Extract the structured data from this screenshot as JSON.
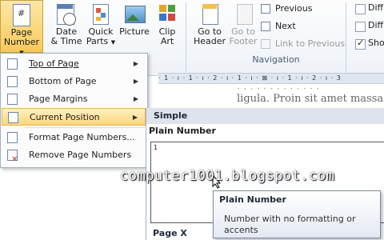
{
  "ribbon": {
    "buttons": [
      {
        "label1": "Page",
        "label2": "Number"
      },
      {
        "label1": "Date",
        "label2": "& Time"
      },
      {
        "label1": "Quick",
        "label2": "Parts"
      },
      {
        "label1": "Picture",
        "label2": ""
      },
      {
        "label1": "Clip",
        "label2": "Art"
      },
      {
        "label1": "Go to",
        "label2": "Header"
      },
      {
        "label1": "Go to",
        "label2": "Footer"
      }
    ],
    "nav": {
      "previous": "Previous",
      "next": "Next",
      "link_to_previous": "Link to Previous",
      "group_label": "Navigation"
    },
    "options": [
      "Diff",
      "Diff",
      "Show"
    ]
  },
  "menu": {
    "items": [
      {
        "label": "Top of Page"
      },
      {
        "label": "Bottom of Page"
      },
      {
        "label": "Page Margins"
      },
      {
        "label": "Current Position"
      },
      {
        "label": "Format Page Numbers..."
      },
      {
        "label": "Remove Page Numbers"
      }
    ]
  },
  "ruler": {
    "text": "· 1 · ı · 1 · ı · 2 · ı · 1 · ı · ⊠ · ı · 1 · ı · 2 · ı · 3"
  },
  "document": {
    "line1": "ligula. Proin sit amet massa at"
  },
  "gallery": {
    "section_simple": "Simple",
    "plain_number": "Plain Number",
    "preview_number": "1",
    "page_x": "Page X"
  },
  "tooltip": {
    "title": "Plain Number",
    "text_line1": "Number with no formatting or",
    "text_line2": "accents"
  },
  "watermark": "computer1001.blogspot.com",
  "colors": {
    "highlight": "#fcd57a",
    "accent_blue": "#2b579a"
  }
}
